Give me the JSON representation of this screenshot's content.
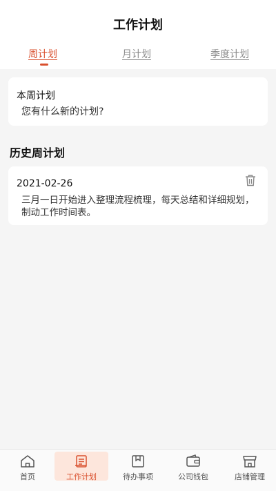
{
  "header": {
    "title": "工作计划"
  },
  "tabs": [
    {
      "label": "周计划",
      "active": true
    },
    {
      "label": "月计划",
      "active": false
    },
    {
      "label": "季度计划",
      "active": false
    }
  ],
  "this_week": {
    "label": "本周计划",
    "placeholder": "您有什么新的计划?"
  },
  "history": {
    "title": "历史周计划",
    "items": [
      {
        "date": "2021-02-26",
        "content": "三月一日开始进入整理流程梳理，每天总结和详细规划，制动工作时间表。"
      }
    ]
  },
  "bottom_nav": [
    {
      "label": "首页",
      "icon": "home-icon",
      "active": false
    },
    {
      "label": "工作计划",
      "icon": "plan-icon",
      "active": true
    },
    {
      "label": "待办事项",
      "icon": "todo-icon",
      "active": false
    },
    {
      "label": "公司钱包",
      "icon": "wallet-icon",
      "active": false
    },
    {
      "label": "店铺管理",
      "icon": "store-icon",
      "active": false
    }
  ],
  "colors": {
    "accent": "#d9502e",
    "active_nav_bg": "#fde6dc",
    "background": "#f5f5f5"
  }
}
